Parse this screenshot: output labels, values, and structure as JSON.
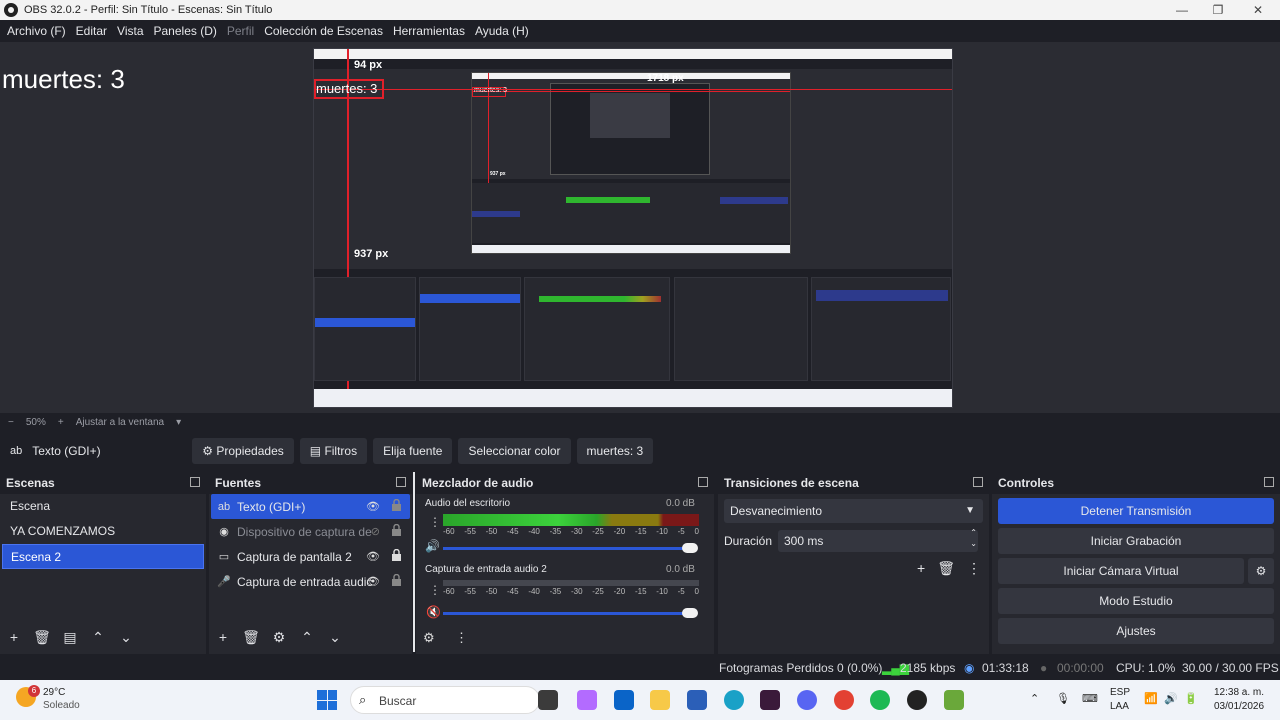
{
  "window": {
    "title": "OBS 32.0.2 - Perfil: Sin Título - Escenas: Sin Título",
    "minimize": "—",
    "maximize": "❐",
    "close": "✕"
  },
  "menu": [
    "Archivo (F)",
    "Editar",
    "Vista",
    "Paneles (D)",
    "Perfil",
    "Colección de Escenas",
    "Herramientas",
    "Ayuda (H)"
  ],
  "preview": {
    "text_overlay": "muertes: 3",
    "nested_label": "muertes: 3",
    "measure_top": "94 px",
    "measure_right": "1718 px",
    "measure_bottom": "937 px",
    "inner_measure": "937 px",
    "inner_label": "muertes: 3"
  },
  "zoom": {
    "minus": "−",
    "value": "50%",
    "plus": "+",
    "fit": "Ajustar a la ventana"
  },
  "propbar": {
    "source": "Texto (GDI+)",
    "properties": "Propiedades",
    "filters": "Filtros",
    "font": "Elija fuente",
    "color": "Seleccionar color",
    "text": "muertes: 3"
  },
  "scenes": {
    "title": "Escenas",
    "items": [
      "Escena",
      "YA COMENZAMOS",
      "Escena 2"
    ],
    "selected": 2
  },
  "sources": {
    "title": "Fuentes",
    "items": [
      "Texto (GDI+)",
      "Dispositivo de captura de",
      "Captura de pantalla 2",
      "Captura de entrada audic"
    ],
    "icons": [
      "text-icon",
      "camera-icon",
      "monitor-icon",
      "mic-icon"
    ]
  },
  "mixer": {
    "title": "Mezclador de audio",
    "tracks": [
      {
        "name": "Audio del escritorio",
        "level": "0.0 dB",
        "volume": 1.0,
        "muted": false
      },
      {
        "name": "Captura de entrada audio 2",
        "level": "0.0 dB",
        "volume": 1.0,
        "muted": true
      }
    ],
    "scale": [
      "-60",
      "-55",
      "-50",
      "-45",
      "-40",
      "-35",
      "-30",
      "-25",
      "-20",
      "-15",
      "-10",
      "-5",
      "0"
    ]
  },
  "transitions": {
    "title": "Transiciones de escena",
    "selected": "Desvanecimiento",
    "duration_label": "Duración",
    "duration_value": "300 ms"
  },
  "controls": {
    "title": "Controles",
    "buttons": [
      "Detener Transmisión",
      "Iniciar Grabación",
      "Iniciar Cámara Virtual",
      "Modo Estudio",
      "Ajustes"
    ]
  },
  "status": {
    "dropped": "Fotogramas Perdidos 0 (0.0%)",
    "bitrate": "2185 kbps",
    "stream_time": "01:33:18",
    "rec_time": "00:00:00",
    "cpu": "CPU: 1.0%",
    "fps": "30.00 / 30.00 FPS"
  },
  "taskbar": {
    "weather_badge": "6",
    "temp": "29°C",
    "cond": "Soleado",
    "search": "Buscar",
    "lang1": "ESP",
    "lang2": "LAA",
    "time": "12:38 a. m.",
    "date": "03/01/2026"
  },
  "colors": {
    "accent": "#2b57d6",
    "measure": "#e0202a",
    "bg": "#1e1f26",
    "panel": "#27282f"
  }
}
